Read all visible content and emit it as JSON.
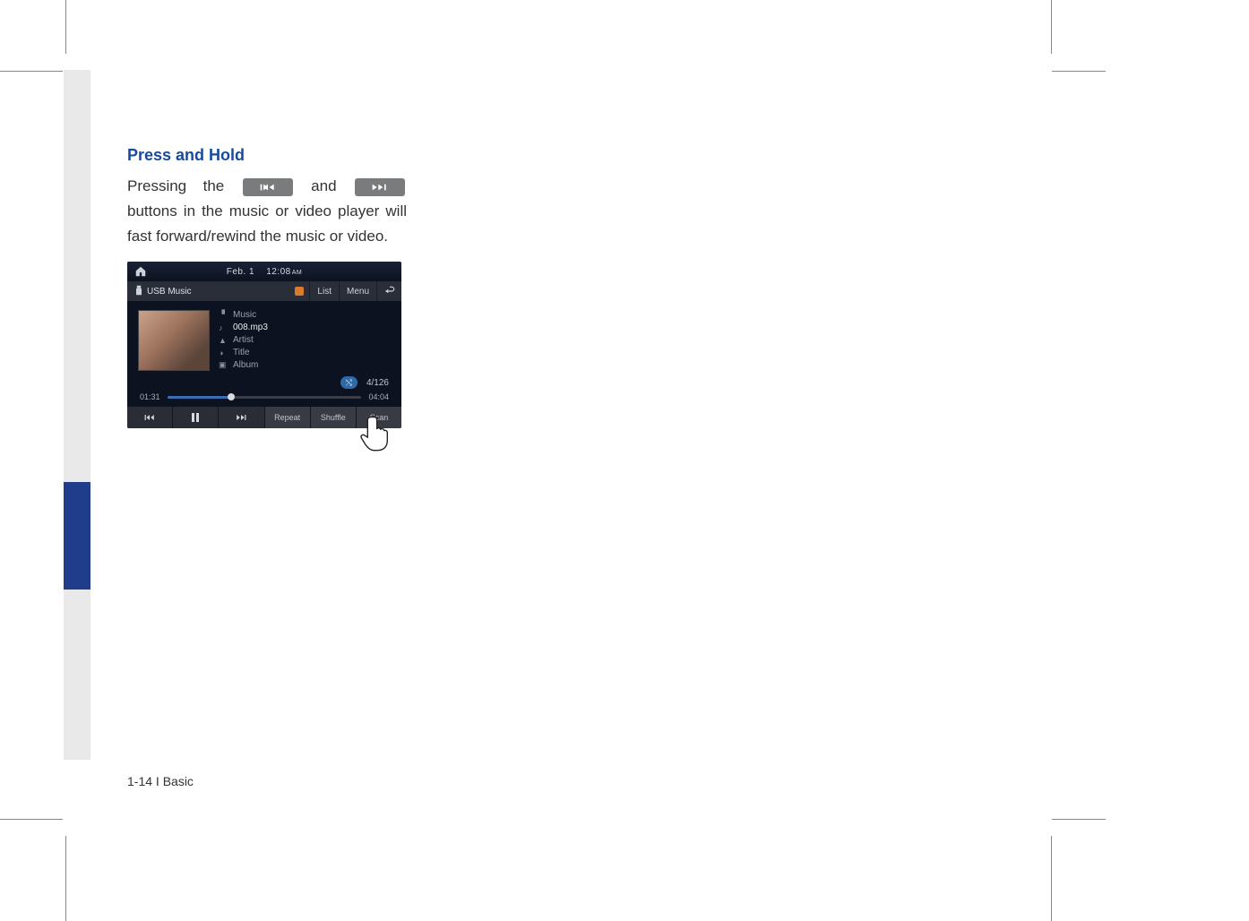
{
  "heading": "Press and Hold",
  "body": {
    "pre": "Pressing the ",
    "mid": " and ",
    "post": " buttons in the music or video player will fast forward/rewind the music or video."
  },
  "screenshot": {
    "date_label": "Feb.  1",
    "time": "12:08",
    "ampm": "AM",
    "source_label": "USB Music",
    "list_btn": "List",
    "menu_btn": "Menu",
    "meta": {
      "folder": "Music",
      "track": "008.mp3",
      "artist_label": "Artist",
      "title_label": "Title",
      "album_label": "Album"
    },
    "shuffle_glyph": "⤭",
    "track_count": "4/126",
    "elapsed": "01:31",
    "total": "04:04",
    "controls": {
      "repeat": "Repeat",
      "shuffle": "Shuffle",
      "scan": "Scan"
    }
  },
  "footer": "1-14 I Basic"
}
